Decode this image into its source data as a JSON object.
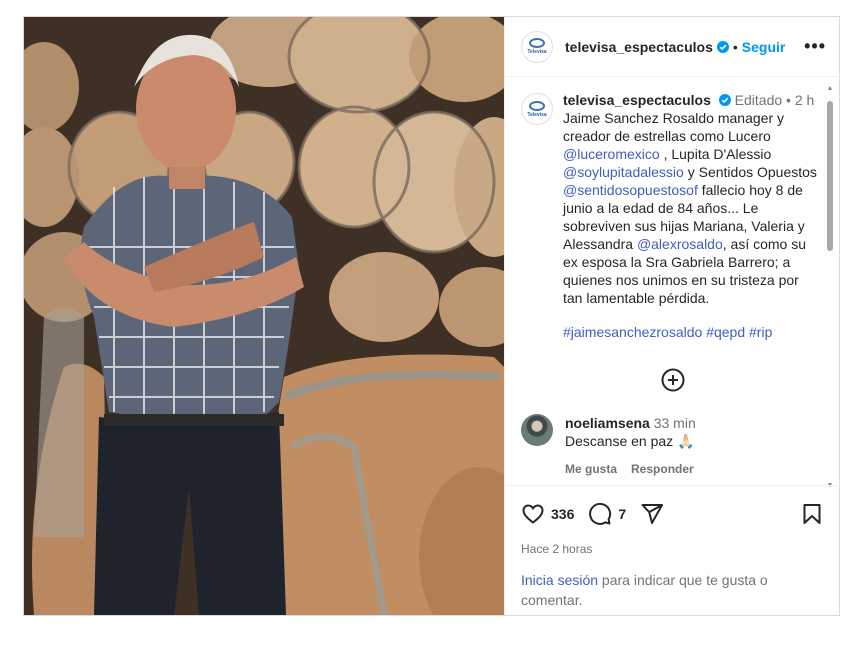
{
  "post": {
    "author": "televisa_espectaculos",
    "avatar_text": "Televisa",
    "follow_dot": "•",
    "follow_label": "Seguir",
    "more_label": "•••",
    "edited_label": "Editado",
    "time_sep": "•",
    "time_ago": "2 h",
    "caption": {
      "p1": "Jaime Sanchez Rosaldo manager y creador de estrellas como Lucero ",
      "m1": "@luceromexico",
      "p2": " , Lupita D'Alessio ",
      "m2": "@soylupitadalessio",
      "p3": " y Sentidos Opuestos ",
      "m3": "@sentidosopuestosof",
      "p4": " fallecio hoy 8 de junio a la edad de 84 años... Le sobreviven sus hijas Mariana, Valeria y Alessandra ",
      "m4": "@alexrosaldo",
      "p5": ", así como su ex esposa la Sra Gabriela Barrero; a quienes nos unimos en su tristeza por tan lamentable pérdida.",
      "hashtags": "#jaimesanchezrosaldo #qepd #rip"
    },
    "likes": "336",
    "comments_count": "7",
    "posted_ago": "Hace 2 horas"
  },
  "comment": {
    "user": "noeliamsena",
    "time": "33 min",
    "text": "Descanse en paz 🙏🏻",
    "like_label": "Me gusta",
    "reply_label": "Responder"
  },
  "login": {
    "signin": "Inicia sesión",
    "rest": " para indicar que te gusta o comentar."
  },
  "colors": {
    "link": "#3d5ec5",
    "follow": "#0095f6",
    "verified": "#0095f6"
  }
}
